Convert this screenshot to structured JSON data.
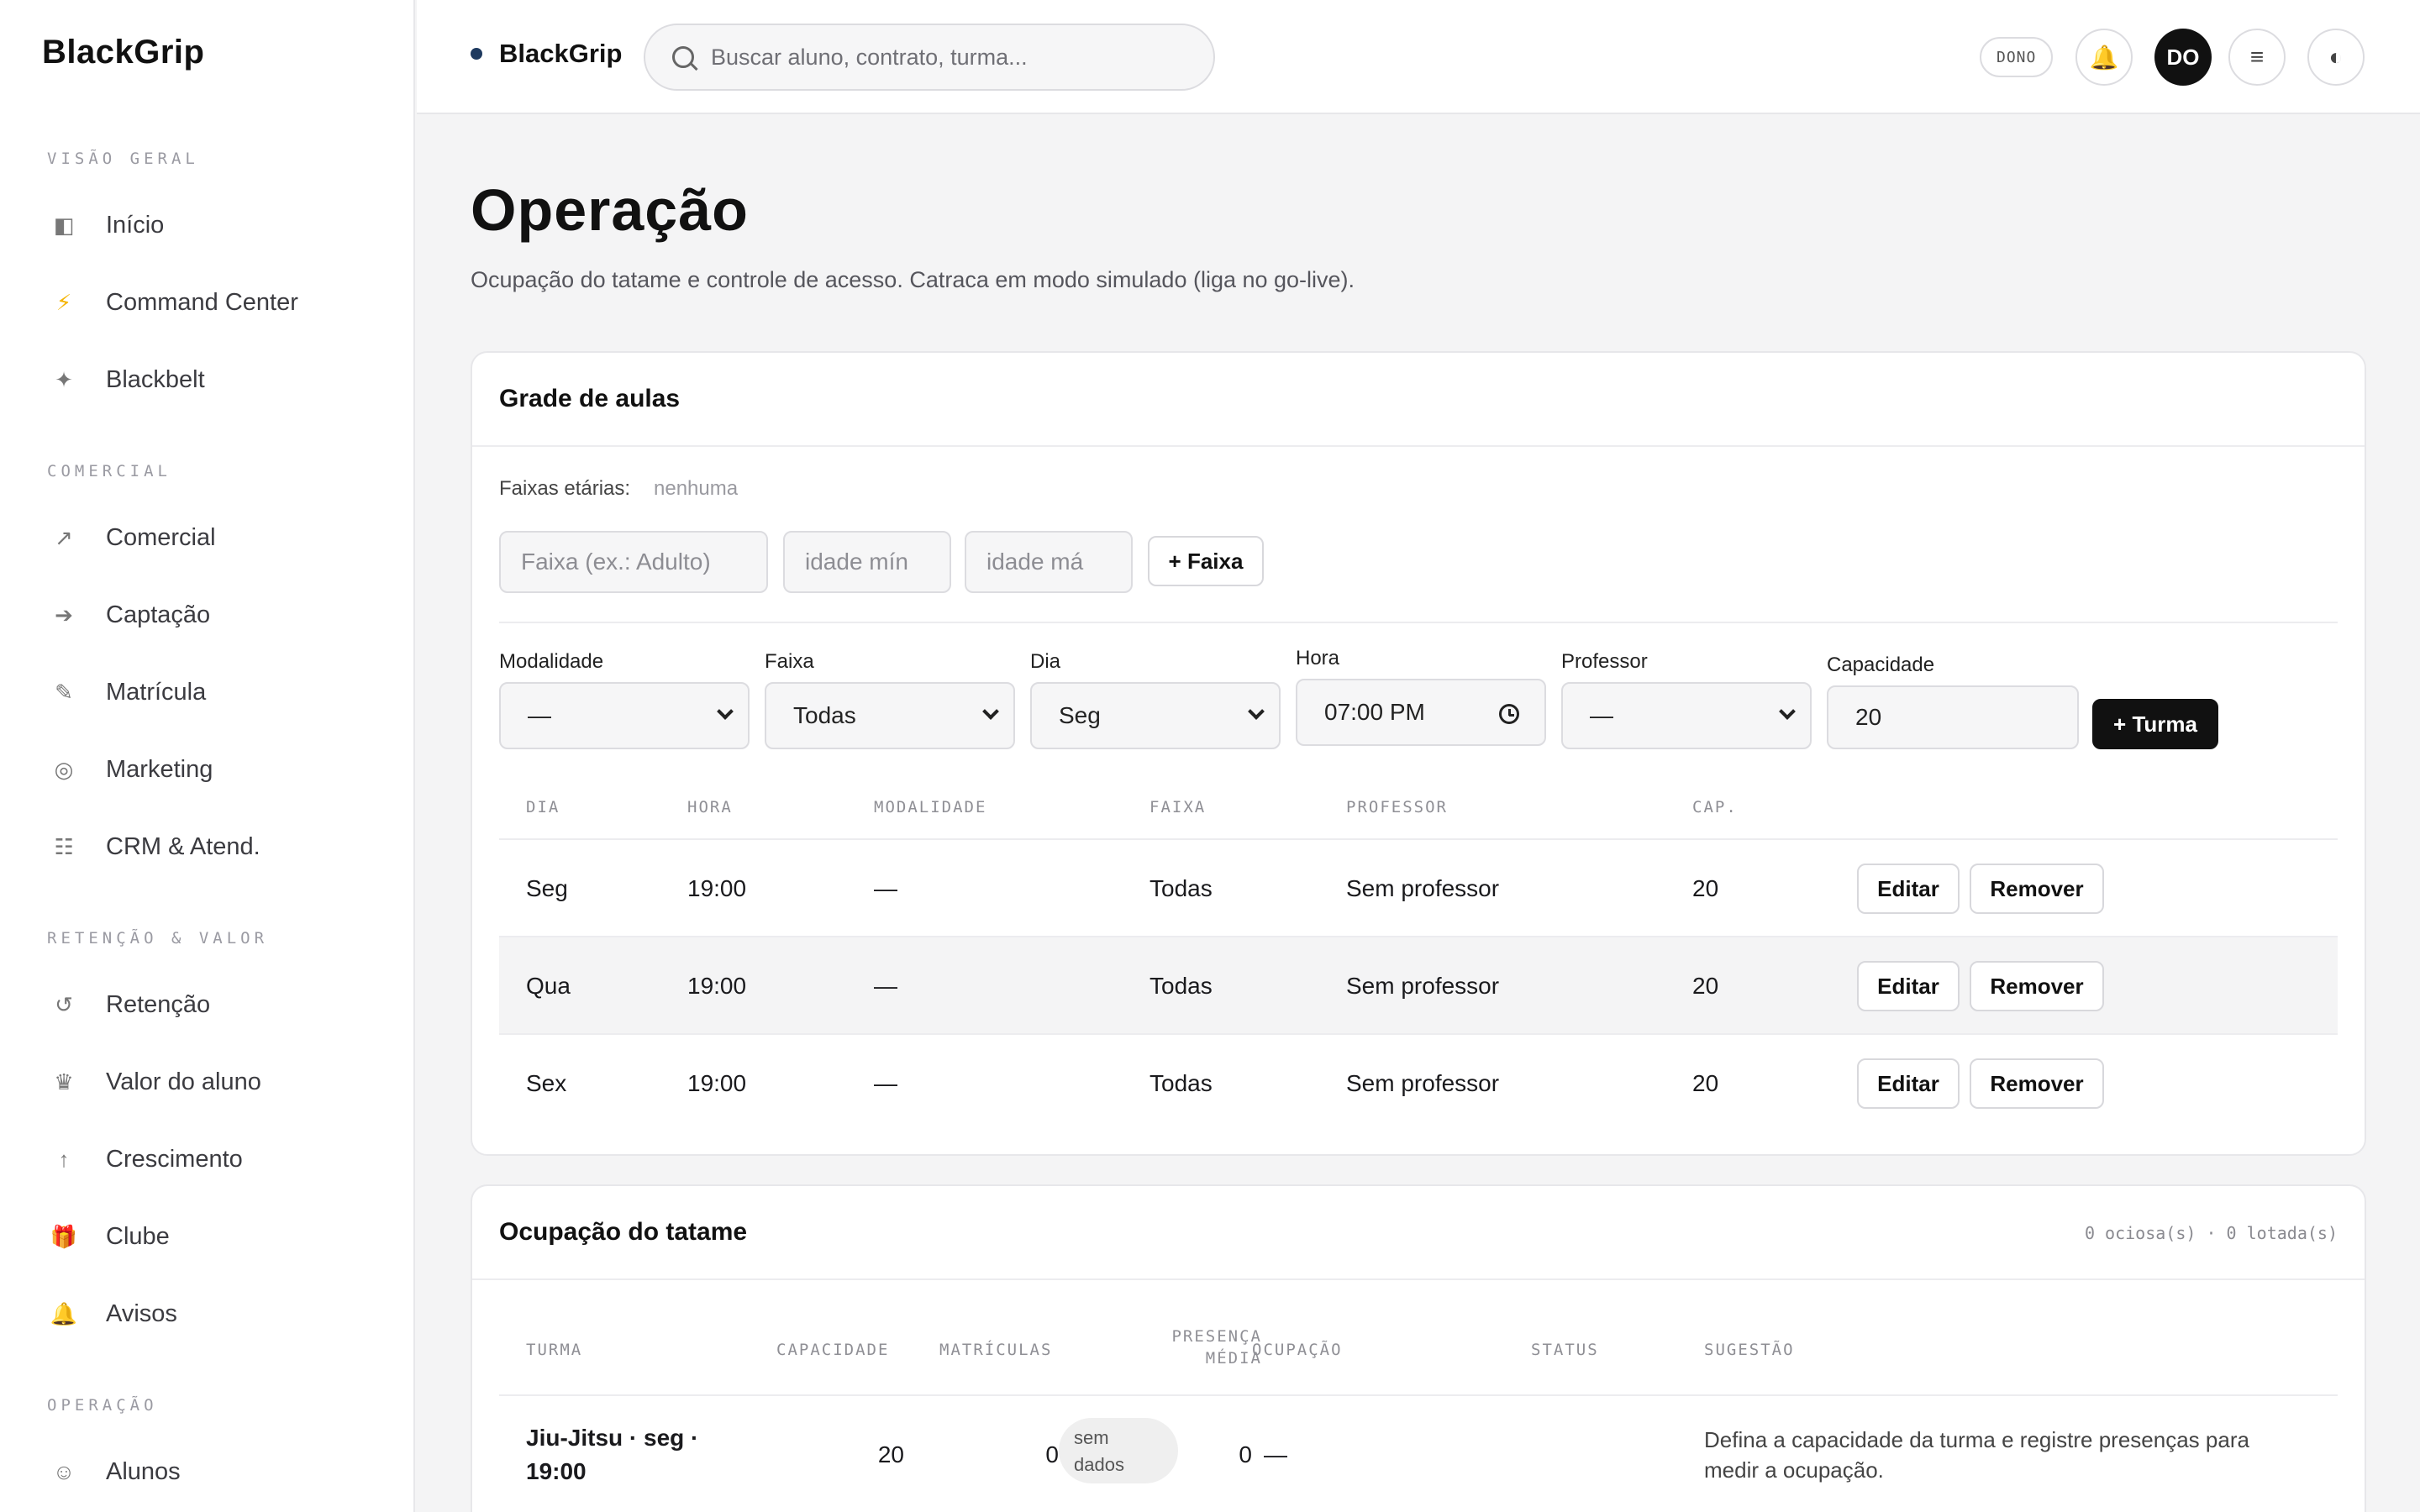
{
  "sidebar": {
    "brand": "BlackGrip",
    "sections": [
      {
        "label": "VISÃO GERAL",
        "items": [
          {
            "icon": "dashboard-icon",
            "glyph": "◧",
            "label": "Início"
          },
          {
            "icon": "bolt-icon",
            "glyph": "⚡",
            "label": "Command Center"
          },
          {
            "icon": "sparkle-icon",
            "glyph": "✦",
            "label": "Blackbelt"
          }
        ]
      },
      {
        "label": "COMERCIAL",
        "items": [
          {
            "icon": "trend-icon",
            "glyph": "↗",
            "label": "Comercial"
          },
          {
            "icon": "arrow-right-icon",
            "glyph": "➔",
            "label": "Captação"
          },
          {
            "icon": "pencil-icon",
            "glyph": "✎",
            "label": "Matrícula"
          },
          {
            "icon": "target-icon",
            "glyph": "◎",
            "label": "Marketing"
          },
          {
            "icon": "list-icon",
            "glyph": "☷",
            "label": "CRM & Atend."
          }
        ]
      },
      {
        "label": "RETENÇÃO & VALOR",
        "items": [
          {
            "icon": "refresh-icon",
            "glyph": "↺",
            "label": "Retenção"
          },
          {
            "icon": "crown-icon",
            "glyph": "♛",
            "label": "Valor do aluno"
          },
          {
            "icon": "arrow-up-icon",
            "glyph": "↑",
            "label": "Crescimento"
          },
          {
            "icon": "gift-icon",
            "glyph": "🎁",
            "label": "Clube"
          },
          {
            "icon": "bell-icon",
            "glyph": "🔔",
            "label": "Avisos"
          }
        ]
      },
      {
        "label": "OPERAÇÃO",
        "items": [
          {
            "icon": "smile-icon",
            "glyph": "☺",
            "label": "Alunos"
          }
        ]
      }
    ]
  },
  "topbar": {
    "brand": "BlackGrip",
    "search_placeholder": "Buscar aluno, contrato, turma...",
    "role": "DONO",
    "bell_glyph": "🔔",
    "avatar": "DO",
    "menu_glyph": "≡",
    "theme_glyph": "◐"
  },
  "page": {
    "title": "Operação",
    "subtitle": "Ocupação do tatame e controle de acesso. Catraca em modo simulado (liga no go-live)."
  },
  "grade": {
    "title": "Grade de aulas",
    "faixas_label": "Faixas etárias:",
    "faixas_value": "nenhuma",
    "faixa_name_placeholder": "Faixa (ex.: Adulto)",
    "idade_min_placeholder": "idade mín",
    "idade_max_placeholder": "idade má",
    "add_faixa_label": "+ Faixa",
    "form": {
      "modalidade_label": "Modalidade",
      "modalidade_value": "—",
      "faixa_label": "Faixa",
      "faixa_value": "Todas",
      "dia_label": "Dia",
      "dia_value": "Seg",
      "hora_label": "Hora",
      "hora_value": "07:00 PM",
      "professor_label": "Professor",
      "professor_value": "—",
      "capacidade_label": "Capacidade",
      "capacidade_value": "20",
      "add_turma_label": "+ Turma"
    },
    "columns": [
      "DIA",
      "HORA",
      "MODALIDADE",
      "FAIXA",
      "PROFESSOR",
      "CAP."
    ],
    "rows": [
      {
        "dia": "Seg",
        "hora": "19:00",
        "modalidade": "—",
        "faixa": "Todas",
        "professor": "Sem professor",
        "cap": "20"
      },
      {
        "dia": "Qua",
        "hora": "19:00",
        "modalidade": "—",
        "faixa": "Todas",
        "professor": "Sem professor",
        "cap": "20"
      },
      {
        "dia": "Sex",
        "hora": "19:00",
        "modalidade": "—",
        "faixa": "Todas",
        "professor": "Sem professor",
        "cap": "20"
      }
    ],
    "edit_label": "Editar",
    "remove_label": "Remover"
  },
  "ocupacao": {
    "title": "Ocupação do tatame",
    "summary": "0 ociosa(s) · 0 lotada(s)",
    "columns": {
      "turma": "TURMA",
      "capacidade": "CAPACIDADE",
      "matriculas": "MATRÍCULAS",
      "presenca_1": "PRESENÇA",
      "presenca_2": "MÉDIA",
      "ocupacao": "OCUPAÇÃO",
      "status": "STATUS",
      "sugestao": "SUGESTÃO"
    },
    "rows": [
      {
        "turma_1": "Jiu-Jitsu · seg ·",
        "turma_2": "19:00",
        "capacidade": "20",
        "matriculas": "0",
        "presenca": "0",
        "ocupacao": "—",
        "status_1": "sem",
        "status_2": "dados",
        "sugestao_1": "Defina a capacidade da turma e registre presenças para",
        "sugestao_2": "medir a ocupação."
      }
    ]
  }
}
